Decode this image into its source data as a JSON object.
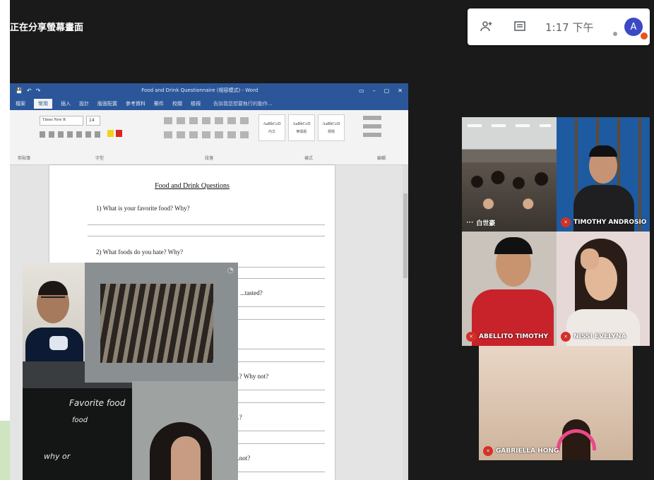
{
  "meet": {
    "presenting_label": "正在分享螢幕畫面",
    "time": "1:17 下午",
    "avatar_letter": "A",
    "icons": [
      "people-icon",
      "chat-icon"
    ]
  },
  "word": {
    "window_title": "Food and Drink Questionnaire (相容模式) - Word",
    "quick_access": [
      "💾",
      "↶",
      "↷"
    ],
    "window_controls": [
      "▭",
      "–",
      "▢",
      "✕"
    ],
    "tabs": [
      "檔案",
      "常用",
      "插入",
      "設計",
      "版面配置",
      "參考資料",
      "郵件",
      "校閱",
      "檢視"
    ],
    "active_tab": 1,
    "tell_me": "告訴我您想要執行的動作...",
    "font_name": "Times New R",
    "font_size": "14",
    "styles": [
      {
        "sample": "AaBbCcD",
        "name": "內文"
      },
      {
        "sample": "AaBbCcD",
        "name": "無間距"
      },
      {
        "sample": "AaBbCcD",
        "name": "標題"
      }
    ],
    "ribbon_groups": [
      "剪貼簿",
      "字型",
      "段落",
      "樣式",
      "編輯"
    ],
    "document": {
      "title": "Food and Drink Questions",
      "questions": [
        "1)  What is your favorite food? Why?",
        "2)  What foods do you hate? Why?",
        "...tasted?",
        "...? Why not?",
        "...?",
        "...not?"
      ]
    }
  },
  "teacher_cam": {
    "board_text_1": "Favorite food",
    "board_text_2": "why or",
    "board_text_3": "food"
  },
  "participants": [
    {
      "name": "白世豪",
      "muted": false
    },
    {
      "name": "TIMOTHY ANDROSIO",
      "muted": true
    },
    {
      "name": "ABELLITO TIMOTHY",
      "muted": true
    },
    {
      "name": "NISSI EVELYNA",
      "muted": true
    },
    {
      "name": "GABRIELLA HONG",
      "muted": true
    }
  ],
  "colors": {
    "word_blue": "#2b579a",
    "meet_background": "#1a1a1a",
    "mute_red": "#d93025",
    "avatar_blue": "#3b49c4"
  }
}
